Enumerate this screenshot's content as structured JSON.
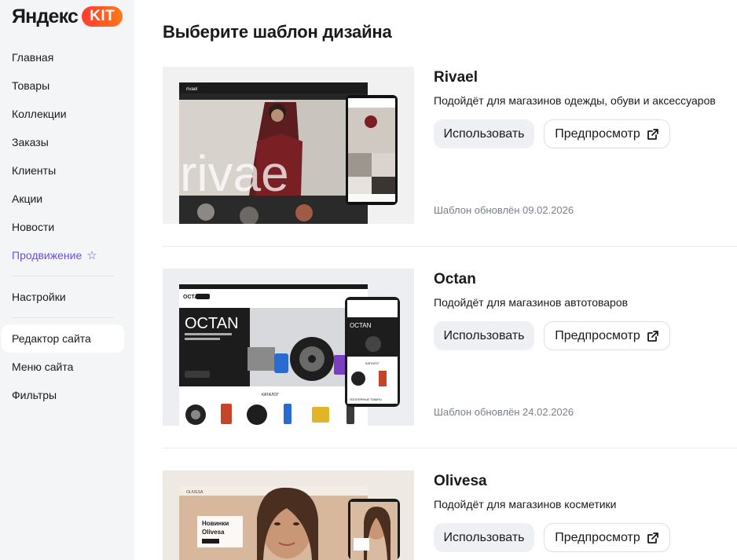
{
  "brand": {
    "name": "Яндекс",
    "badge": "KIT"
  },
  "sidebar": {
    "items": [
      {
        "label": "Главная"
      },
      {
        "label": "Товары"
      },
      {
        "label": "Коллекции"
      },
      {
        "label": "Заказы"
      },
      {
        "label": "Клиенты"
      },
      {
        "label": "Акции"
      },
      {
        "label": "Новости"
      },
      {
        "label": "Продвижение"
      }
    ],
    "settings": {
      "label": "Настройки"
    },
    "site": [
      {
        "label": "Редактор сайта"
      },
      {
        "label": "Меню сайта"
      },
      {
        "label": "Фильтры"
      }
    ]
  },
  "main": {
    "title": "Выберите шаблон дизайна",
    "use_label": "Использовать",
    "preview_label": "Предпросмотр",
    "templates": [
      {
        "name": "Rivael",
        "description": "Подойдёт для магазинов одежды, обуви и аксессуаров",
        "updated": "Шаблон обновлён 09.02.2026",
        "preview": {
          "logo": "rivael",
          "hero": "rivae"
        }
      },
      {
        "name": "Octan",
        "description": "Подойдёт для магазинов автотоваров",
        "updated": "Шаблон обновлён 24.02.2026",
        "preview": {
          "logo": "OCTAN",
          "hero": "OCTAN",
          "phone_hero": "OCTAN",
          "catalog": "КАТАЛОГ",
          "phone_catalog": "КАТАЛОГ",
          "popular": "ПОПУЛЯРНЫЕ ТОВАРЫ"
        }
      },
      {
        "name": "Olivesa",
        "description": "Подойдёт для магазинов косметики",
        "updated": "",
        "preview": {
          "logo": "OLIVESA",
          "hero_line1": "Новинки",
          "hero_line2": "Olivesa"
        }
      }
    ]
  },
  "colors": {
    "promo": "#6b4de6",
    "badge_start": "#ff3b2f",
    "badge_end": "#ff7a1a",
    "sidebar_bg": "#f4f5f7"
  }
}
